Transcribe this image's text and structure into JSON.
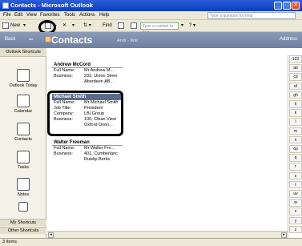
{
  "window": {
    "title": "Contacts - Microsoft Outlook"
  },
  "menu": {
    "items": [
      "File",
      "Edit",
      "View",
      "Favorites",
      "Tools",
      "Actions",
      "Help"
    ],
    "help_placeholder": "Type a question for help"
  },
  "toolbar": {
    "new_label": "New",
    "find_label": "Find",
    "find_contact_placeholder": "Type a contact to find"
  },
  "nav": {
    "back_label": "Back",
    "title": "Contacts",
    "subtitle": "Andr - Wal",
    "address_label": "Address"
  },
  "sidebar": {
    "header": "Outlook Shortcuts",
    "items": [
      {
        "label": "Outlook Today",
        "icon": "outlook-today-icon"
      },
      {
        "label": "Calendar",
        "icon": "calendar-icon"
      },
      {
        "label": "Contacts",
        "icon": "contacts-icon"
      },
      {
        "label": "Tasks",
        "icon": "tasks-icon"
      },
      {
        "label": "Notes",
        "icon": "notes-icon"
      }
    ],
    "my_shortcuts": "My Shortcuts",
    "other_shortcuts": "Other Shortcuts"
  },
  "contacts": [
    {
      "name": "Andrew McCord",
      "rows": [
        {
          "label": "Full Name:",
          "value": "Mr Andrew M..."
        },
        {
          "label": "Business:",
          "value": "232, Union Stree"
        },
        {
          "label": "",
          "value": "Aberdeen AB..."
        }
      ]
    },
    {
      "name": "Michael Smith",
      "selected": true,
      "rows": [
        {
          "label": "Full Name:",
          "value": "Mr Michael Smith"
        },
        {
          "label": "Job Title:",
          "value": "President"
        },
        {
          "label": "Company:",
          "value": "LBI Group"
        },
        {
          "label": "Business:",
          "value": "100, Clean View"
        },
        {
          "label": "",
          "value": "Oxford Oxon..."
        }
      ]
    },
    {
      "name": "Walter Freeman",
      "rows": [
        {
          "label": "Full Name:",
          "value": "Mr Walter Fre..."
        },
        {
          "label": "Business:",
          "value": "401, Cumberlanc"
        },
        {
          "label": "",
          "value": "Ruislip Berks."
        }
      ]
    }
  ],
  "index_tabs": [
    "123",
    "ab",
    "cd",
    "ef",
    "gh",
    "ij",
    "k",
    "l",
    "m",
    "n",
    "op",
    "q",
    "r",
    "s",
    "t",
    "uv",
    "w",
    "x",
    "y",
    "z"
  ],
  "status": {
    "items": "3 Items"
  }
}
